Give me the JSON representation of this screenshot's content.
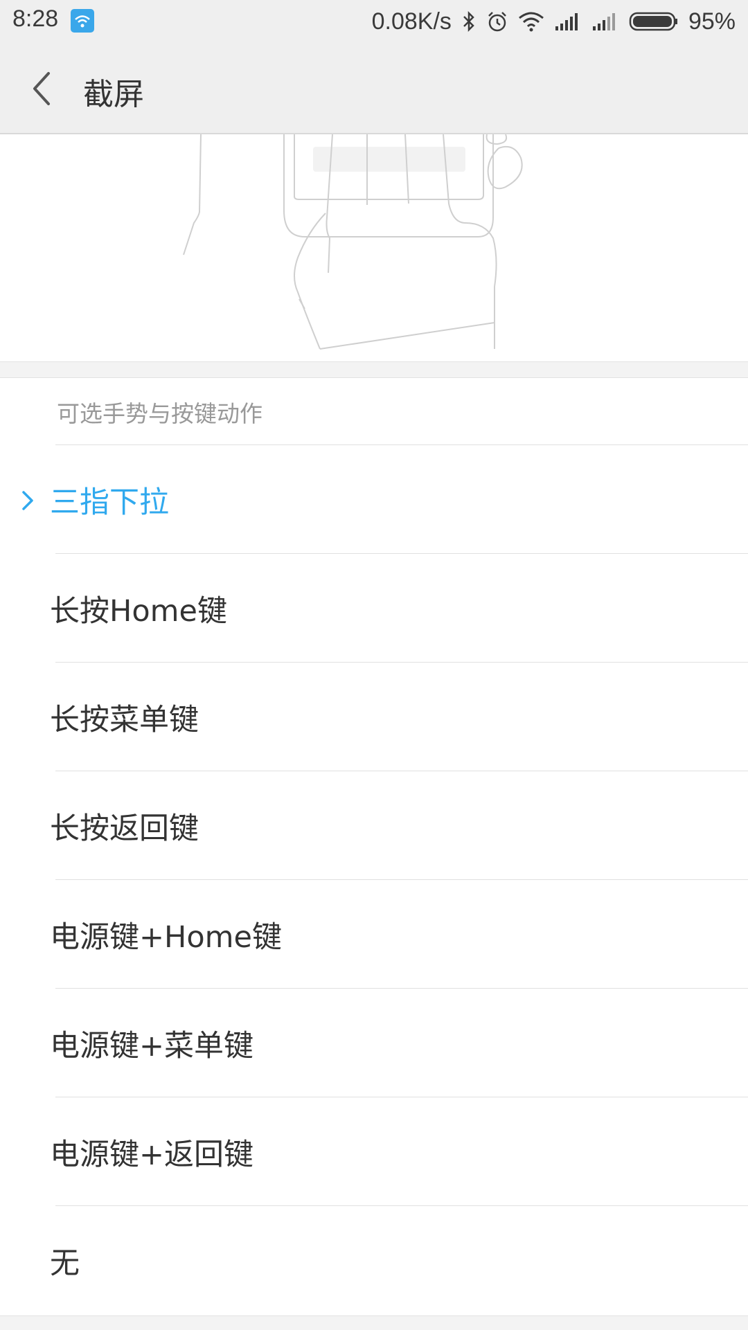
{
  "status_bar": {
    "time": "8:28",
    "net_speed": "0.08K/s",
    "battery": "95%",
    "icons": [
      "wifi-notification-icon",
      "bluetooth-icon",
      "alarm-icon",
      "wifi-icon",
      "signal-icon",
      "signal-icon",
      "battery-icon"
    ],
    "accent": "#3aa7ea"
  },
  "header": {
    "back_icon": "chevron-left-icon",
    "title": "截屏"
  },
  "section": {
    "header": "可选手势与按键动作"
  },
  "options": [
    {
      "label": "三指下拉",
      "selected": true
    },
    {
      "label": "长按Home键",
      "selected": false
    },
    {
      "label": "长按菜单键",
      "selected": false
    },
    {
      "label": "长按返回键",
      "selected": false
    },
    {
      "label": "电源键+Home键",
      "selected": false
    },
    {
      "label": "电源键+菜单键",
      "selected": false
    },
    {
      "label": "电源键+返回键",
      "selected": false
    },
    {
      "label": "无",
      "selected": false
    }
  ],
  "colors": {
    "selected_text": "#30a9ee",
    "text": "#333333",
    "header_text": "#999999"
  }
}
